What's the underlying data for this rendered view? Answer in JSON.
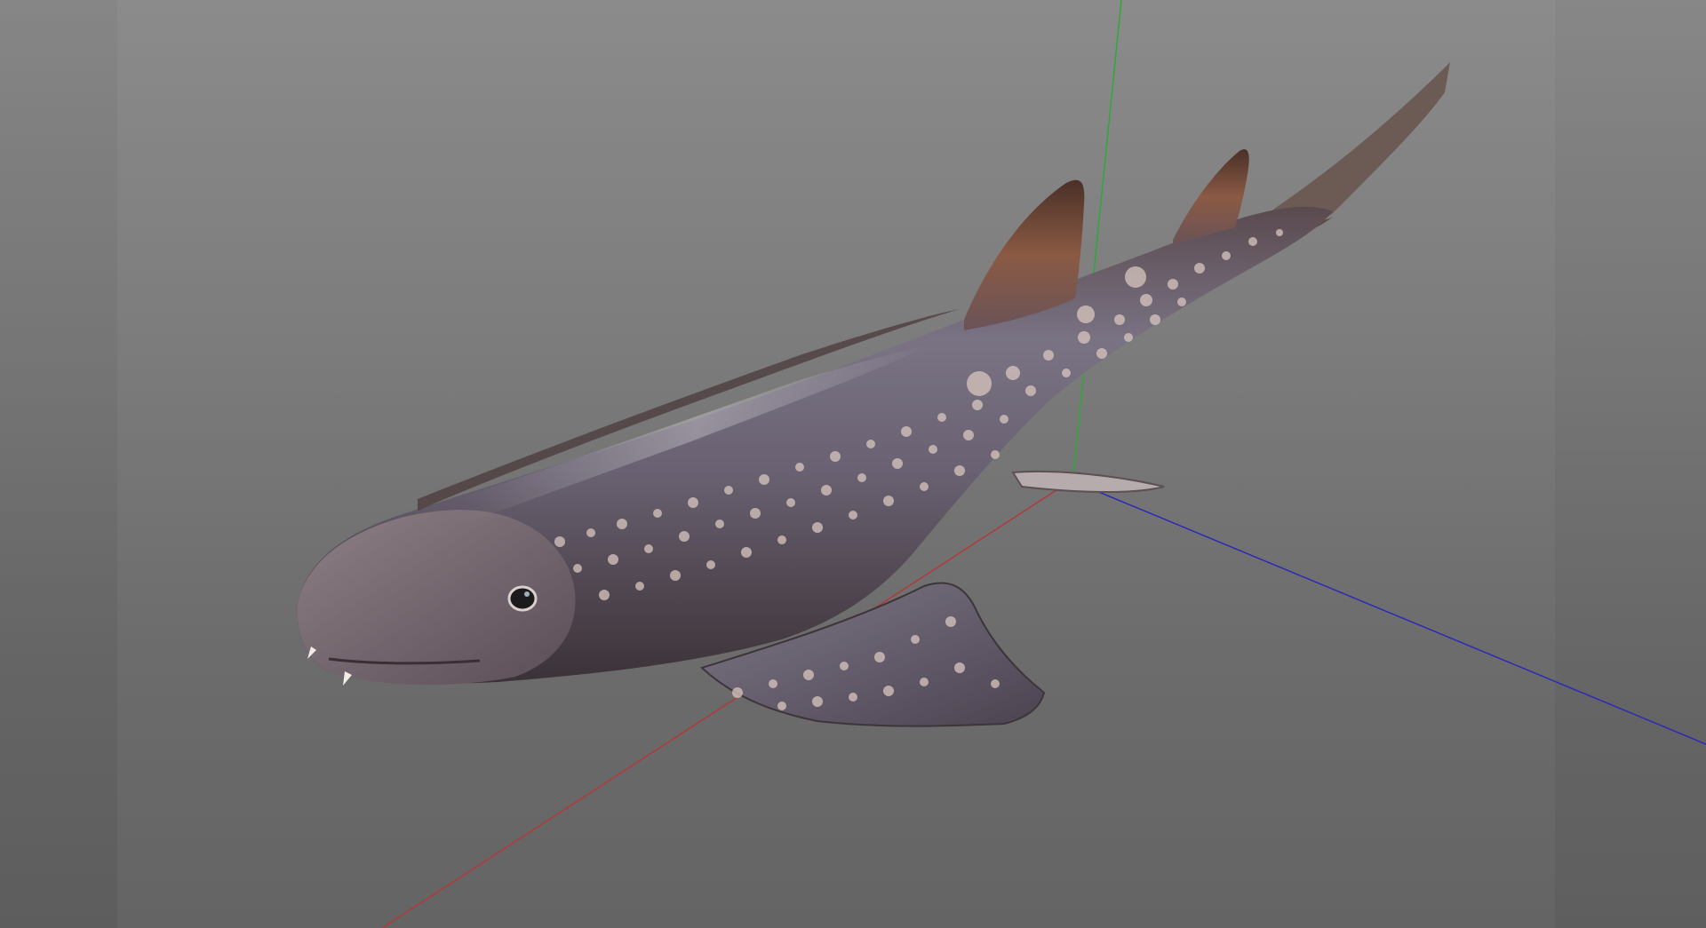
{
  "viewport": {
    "kind": "3d-model-viewer",
    "background_top": "#8b8b8b",
    "background_bottom": "#646464"
  },
  "model": {
    "subject": "shark",
    "skin_color": "#6f6473",
    "belly_color": "#8a7f86",
    "spot_color": "#d8c7bf",
    "fin_color": "#6b4a3c"
  },
  "axes": {
    "x_axis_color": "#b03a3a",
    "y_axis_color": "#2fa83a",
    "z_axis_color": "#2b2bb8"
  }
}
